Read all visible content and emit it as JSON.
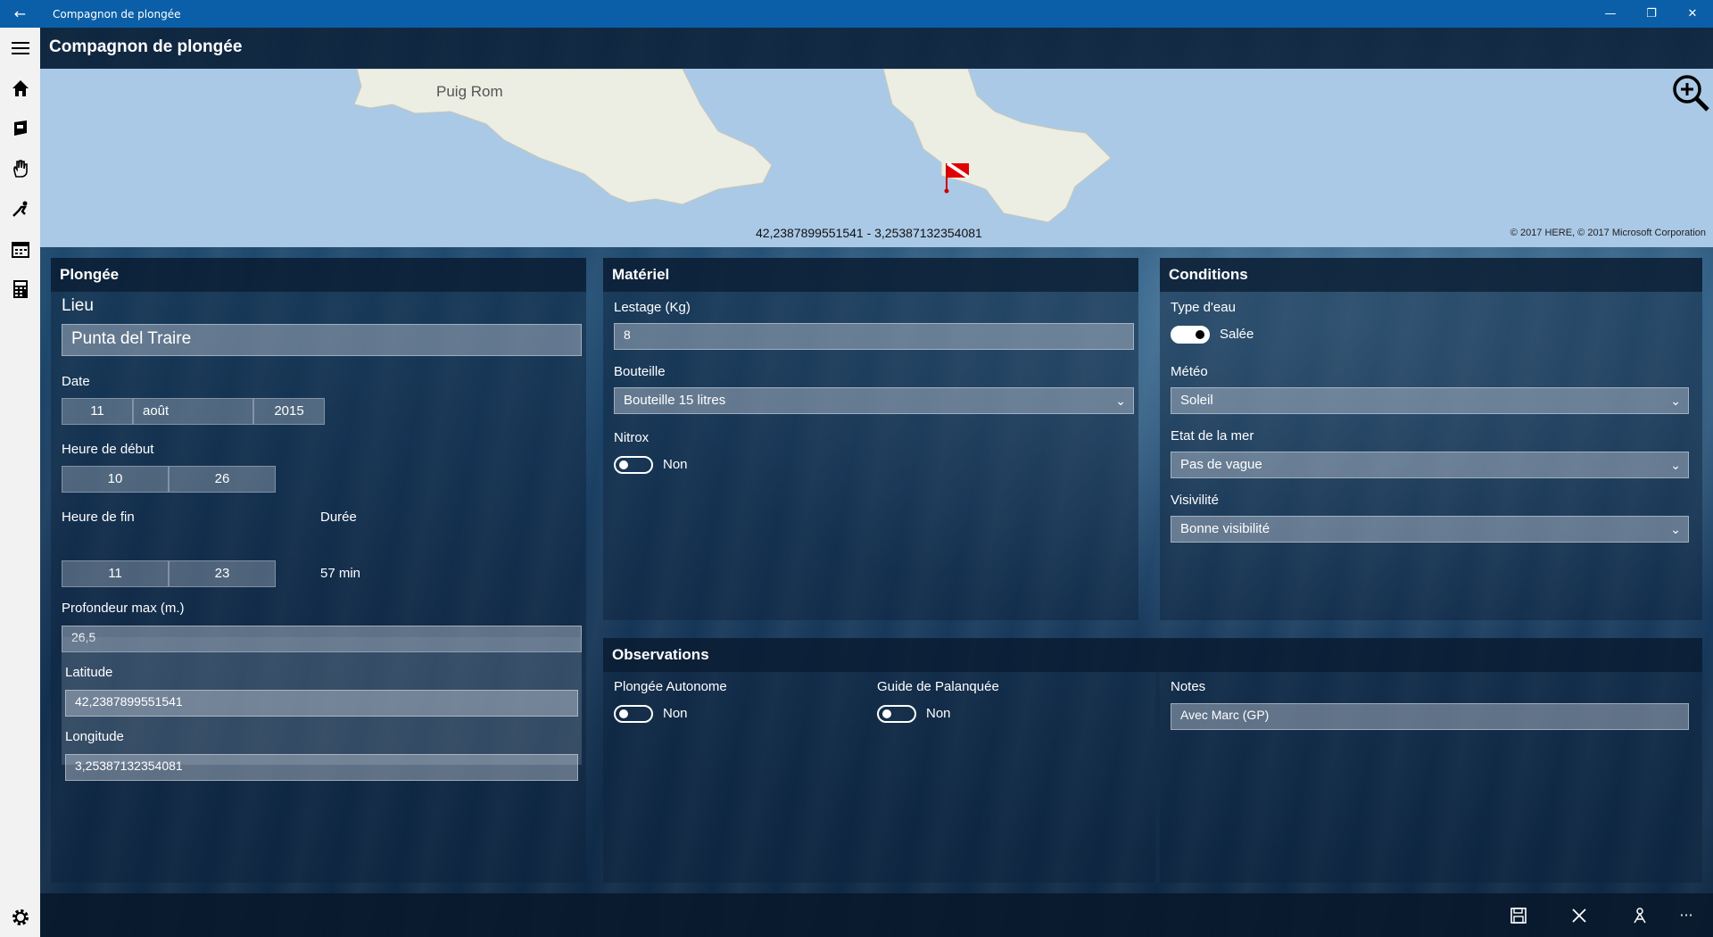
{
  "window": {
    "title": "Compagnon de plongée"
  },
  "app": {
    "title": "Compagnon de plongée"
  },
  "sidebar": {
    "items": [
      "hamburger-menu-icon",
      "home-icon",
      "logbook-icon",
      "hand-sign-icon",
      "diver-icon",
      "calendar-icon",
      "calculator-icon"
    ],
    "settings_icon": "gear-icon"
  },
  "map": {
    "place": "Puig Rom",
    "coords": "42,2387899551541  -  3,25387132354081",
    "copyright": "© 2017 HERE, © 2017 Microsoft Corporation",
    "marker_icon": "dive-flag-icon",
    "zoom_icon": "zoom-in-icon"
  },
  "plongee": {
    "title": "Plongée",
    "lieu_label": "Lieu",
    "lieu_value": "Punta del Traire",
    "date_label": "Date",
    "date_day": "11",
    "date_month": "août",
    "date_year": "2015",
    "debut_label": "Heure de début",
    "debut_h": "10",
    "debut_m": "26",
    "fin_label": "Heure de fin",
    "fin_h": "11",
    "fin_m": "23",
    "duree_label": "Durée",
    "duree_value": "57 min",
    "prof_label": "Profondeur max (m.)",
    "prof_value": "26,5",
    "lat_label": "Latitude",
    "lat_value": "42,2387899551541",
    "lon_label": "Longitude",
    "lon_value": "3,25387132354081"
  },
  "materiel": {
    "title": "Matériel",
    "lestage_label": "Lestage (Kg)",
    "lestage_value": "8",
    "bouteille_label": "Bouteille",
    "bouteille_value": "Bouteille 15 litres",
    "nitrox_label": "Nitrox",
    "nitrox_state": "Non"
  },
  "conditions": {
    "title": "Conditions",
    "eau_label": "Type d'eau",
    "eau_state": "Salée",
    "meteo_label": "Météo",
    "meteo_value": "Soleil",
    "mer_label": "Etat de la mer",
    "mer_value": "Pas de vague",
    "visi_label": "Visivilité",
    "visi_value": "Bonne visibilité"
  },
  "observations": {
    "title": "Observations",
    "autonome_label": "Plongée Autonome",
    "autonome_state": "Non",
    "guide_label": "Guide de Palanquée",
    "guide_state": "Non",
    "notes_label": "Notes",
    "notes_value": "Avec Marc (GP)"
  },
  "commands": [
    "save-icon",
    "close-icon",
    "share-icon",
    "more-icon"
  ],
  "colors": {
    "titlebar": "#0a5fa8",
    "sidebar": "#f2f2f2",
    "map_water": "#aac9e6"
  }
}
